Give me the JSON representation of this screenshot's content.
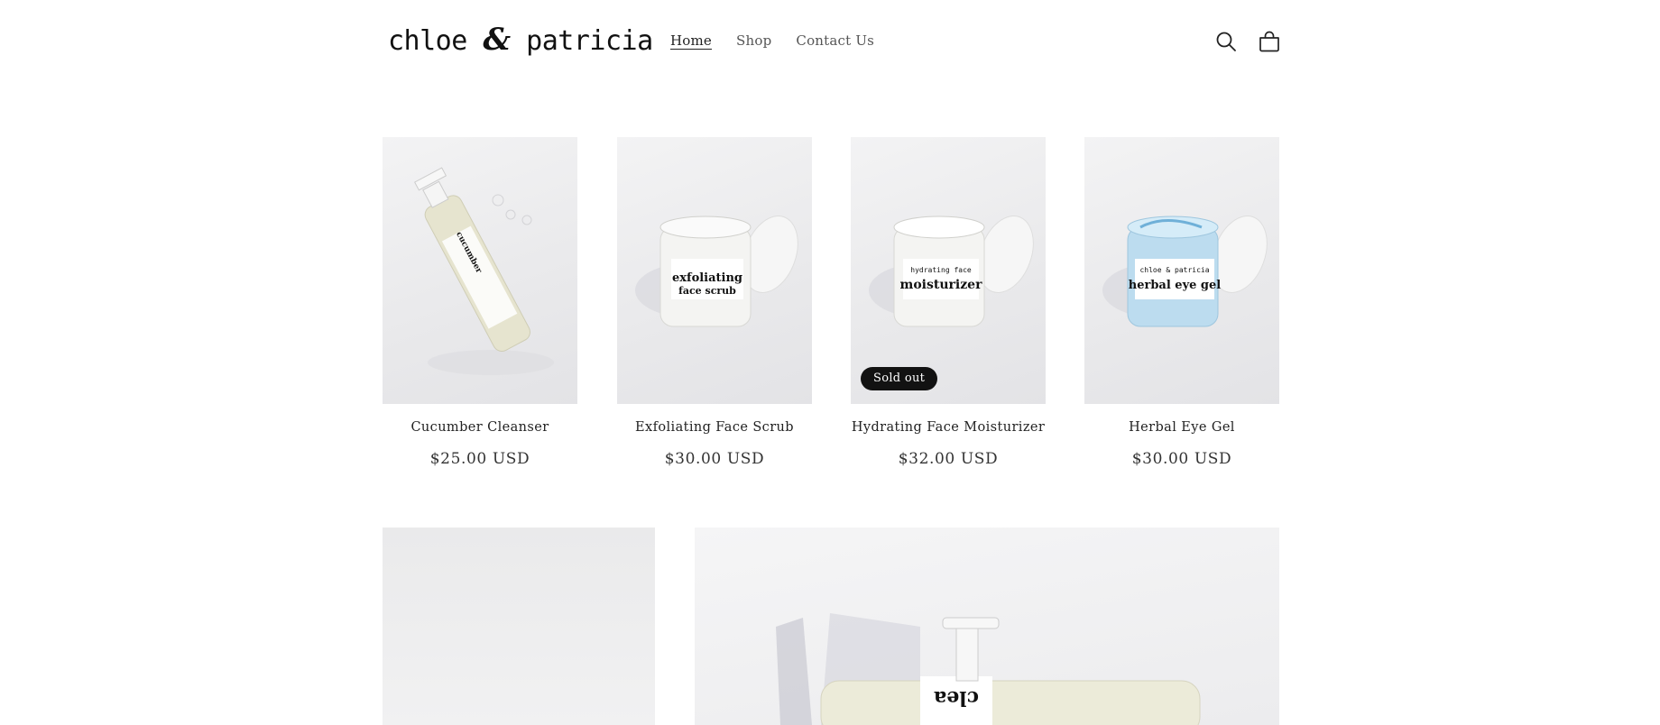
{
  "header": {
    "logo_left": "chloe",
    "logo_amp": "&",
    "logo_right": "patricia",
    "nav": [
      {
        "label": "Home",
        "active": true
      },
      {
        "label": "Shop",
        "active": false
      },
      {
        "label": "Contact Us",
        "active": false
      }
    ],
    "search_icon": "search-icon",
    "cart_icon": "cart-icon"
  },
  "products": [
    {
      "name": "Cucumber Cleanser",
      "price": "$25.00 USD",
      "image": "cleanser-bottle-photo",
      "sold_out": false
    },
    {
      "name": "Exfoliating Face Scrub",
      "price": "$30.00 USD",
      "image": "scrub-jar-photo",
      "sold_out": false
    },
    {
      "name": "Hydrating Face Moisturizer",
      "price": "$32.00 USD",
      "image": "moisturizer-jar-photo",
      "sold_out": true,
      "badge": "Sold out"
    },
    {
      "name": "Herbal Eye Gel",
      "price": "$30.00 USD",
      "image": "eye-gel-jar-photo",
      "sold_out": false
    }
  ],
  "banners": {
    "left_image": "plain-backdrop-photo",
    "right_image": "cleanser-bottles-photo"
  },
  "colors": {
    "text": "#121212",
    "badge_bg": "#121212",
    "badge_text": "#ffffff",
    "background": "#ffffff"
  }
}
